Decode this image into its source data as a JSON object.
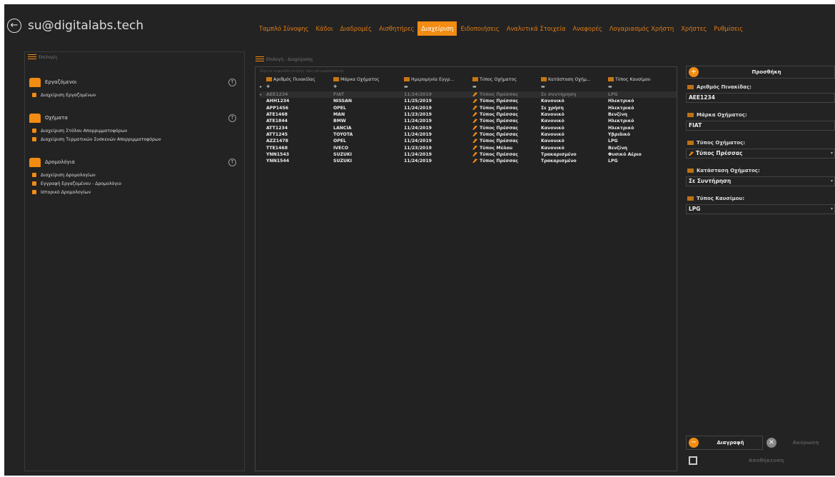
{
  "header": {
    "user": "su@digitalabs.tech",
    "tabs": [
      "Ταμπλό Σύνοψης",
      "Κάδοι",
      "Διαδρομές",
      "Αισθητήρες",
      "Διαχείριση",
      "Ειδοποιήσεις",
      "Αναλυτικά Στοιχεία",
      "Αναφορές",
      "Λογαριασμός Χρήστη",
      "Χρήστες",
      "Ρυθμίσεις"
    ],
    "active_tab": "Διαχείριση",
    "accent": "#f28c12"
  },
  "left": {
    "title": "Επιλογές",
    "groups": [
      {
        "label": "Εργαζόμενοι",
        "items": [
          "Διαχείριση Εργαζομένων"
        ]
      },
      {
        "label": "Οχήματα",
        "items": [
          "Διαχείριση Στόλου Απορριμματοφόρων",
          "Διαχείριση Τερματικών Συσκευών Απορριμματοφόρων"
        ]
      },
      {
        "label": "Δρομολόγια",
        "items": [
          "Διαχείριση Δρομολογίων",
          "Εγγραφή Εργαζομένου - Δρομολόγιο",
          "Ιστορικό Δρομολογίων"
        ]
      }
    ]
  },
  "grid": {
    "title": "Επιλογή - Διαχείρισης",
    "hint": "Σύρετε κεφαλίδα στήλης εδώ για ομαδοποίηση",
    "columns": [
      "Αριθμός Πινακίδας",
      "Μάρκα Οχήματος",
      "Ημερομηνία Εγγρ...",
      "Τύπος Οχήματος",
      "Κατάσταση Οχήμ...",
      "Τύπος Καυσίμου"
    ],
    "rows": [
      [
        "AEE1234",
        "FIAT",
        "11/24/2019",
        "Τύπος Πρέσσας",
        "Σε συντήρηση",
        "LPG"
      ],
      [
        "AHH1234",
        "NISSAN",
        "11/25/2019",
        "Τύπος Πρέσσας",
        "Κανονικό",
        "Ηλεκτρικό"
      ],
      [
        "APP1456",
        "OPEL",
        "11/24/2019",
        "Τύπος Πρέσσας",
        "Σε χρήση",
        "Ηλεκτρικό"
      ],
      [
        "ATE1468",
        "MAN",
        "11/23/2019",
        "Τύπος Πρέσσας",
        "Κανονικό",
        "Βενζίνη"
      ],
      [
        "ATE1844",
        "BMW",
        "11/24/2019",
        "Τύπος Πρέσσας",
        "Κανονικό",
        "Ηλεκτρικό"
      ],
      [
        "ATT1234",
        "LANCIA",
        "11/24/2019",
        "Τύπος Πρέσσας",
        "Κανονικό",
        "Ηλεκτρικό"
      ],
      [
        "ATT1245",
        "TOYOTA",
        "11/24/2019",
        "Τύπος Πρέσσας",
        "Κανονικό",
        "Υβριδικό"
      ],
      [
        "AZZ1478",
        "OPEL",
        "11/24/2019",
        "Τύπος Πρέσσας",
        "Κανονικό",
        "LPG"
      ],
      [
        "TTE1468",
        "IVECO",
        "11/23/2019",
        "Τύπος Μύλου",
        "Κανονικό",
        "Βενζίνη"
      ],
      [
        "YNN1543",
        "SUZUKI",
        "11/24/2019",
        "Τύπος Πρέσσας",
        "Τρακαρισμένο",
        "Φυσικό Αέριο"
      ],
      [
        "YNN1544",
        "SUZUKI",
        "11/24/2019",
        "Τύπος Πρέσσας",
        "Τρακαρισμένο",
        "LPG"
      ]
    ]
  },
  "form": {
    "add_label": "Προσθήκη",
    "fields": [
      {
        "label": "Αριθμός Πινακίδας:",
        "value": "AEE1234",
        "dropdown": false
      },
      {
        "label": "Μάρκα Οχήματος:",
        "value": "FIAT",
        "dropdown": false
      },
      {
        "label": "Τύπος Οχήματος:",
        "value": "Τύπος Πρέσσας",
        "dropdown": true
      },
      {
        "label": "Κατάσταση Οχήματος:",
        "value": "Σε Συντήρηση",
        "dropdown": true
      },
      {
        "label": "Τύπος Καυσίμου:",
        "value": "LPG",
        "dropdown": true
      }
    ],
    "delete_label": "Διαγραφή",
    "cancel_label": "Ακύρωση",
    "save_label": "Αποθήκευση"
  }
}
